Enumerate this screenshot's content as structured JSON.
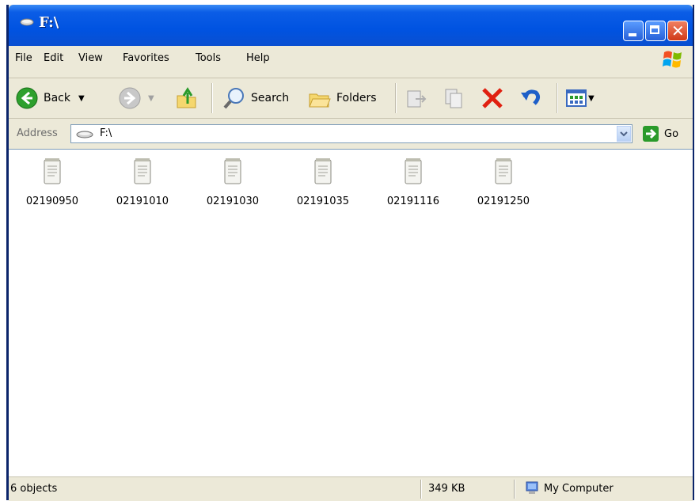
{
  "window": {
    "title": "F:\\"
  },
  "menu": {
    "items": [
      "File",
      "Edit",
      "View",
      "Favorites",
      "Tools",
      "Help"
    ]
  },
  "toolbar": {
    "back_label": "Back",
    "search_label": "Search",
    "folders_label": "Folders"
  },
  "address": {
    "label": "Address",
    "value": "F:\\",
    "go_label": "Go"
  },
  "files": [
    {
      "name": "02190950"
    },
    {
      "name": "02191010"
    },
    {
      "name": "02191030"
    },
    {
      "name": "02191035"
    },
    {
      "name": "02191116"
    },
    {
      "name": "02191250"
    }
  ],
  "status": {
    "objects": "6 objects",
    "size": "349 KB",
    "location": "My Computer"
  },
  "colors": {
    "titlebar": "#0053e1",
    "chrome": "#ece9d8",
    "delete_red": "#e02010",
    "go_green": "#2a9a2a"
  }
}
